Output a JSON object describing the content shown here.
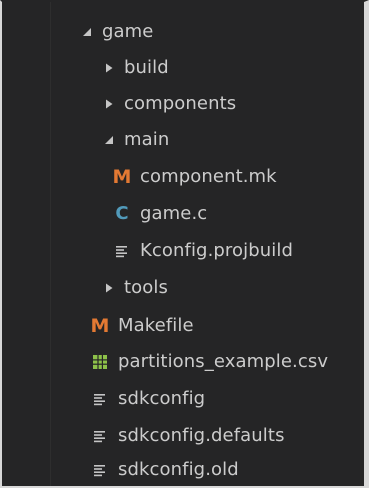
{
  "colors": {
    "background": "#252526",
    "text": "#cccccc",
    "makefile_icon": "#e37933",
    "c_icon": "#519aba",
    "csv_icon": "#8dc149",
    "lines_icon": "#c5c5c5",
    "twisty": "#c5c5c5"
  },
  "tree": {
    "items": [
      {
        "label": "game",
        "kind": "folder",
        "state": "expanded",
        "icon": "chevron-down-icon"
      },
      {
        "label": "build",
        "kind": "folder",
        "state": "collapsed",
        "icon": "chevron-right-icon"
      },
      {
        "label": "components",
        "kind": "folder",
        "state": "collapsed",
        "icon": "chevron-right-icon"
      },
      {
        "label": "main",
        "kind": "folder",
        "state": "expanded",
        "icon": "chevron-down-icon"
      },
      {
        "label": "component.mk",
        "kind": "file",
        "icon": "makefile-icon",
        "glyph": "M"
      },
      {
        "label": "game.c",
        "kind": "file",
        "icon": "c-file-icon",
        "glyph": "C"
      },
      {
        "label": "Kconfig.projbuild",
        "kind": "file",
        "icon": "text-lines-icon"
      },
      {
        "label": "tools",
        "kind": "folder",
        "state": "collapsed",
        "icon": "chevron-right-icon"
      },
      {
        "label": "Makefile",
        "kind": "file",
        "icon": "makefile-icon",
        "glyph": "M"
      },
      {
        "label": "partitions_example.csv",
        "kind": "file",
        "icon": "csv-table-icon"
      },
      {
        "label": "sdkconfig",
        "kind": "file",
        "icon": "text-lines-icon"
      },
      {
        "label": "sdkconfig.defaults",
        "kind": "file",
        "icon": "text-lines-icon"
      },
      {
        "label": "sdkconfig.old",
        "kind": "file",
        "icon": "text-lines-icon"
      }
    ]
  }
}
